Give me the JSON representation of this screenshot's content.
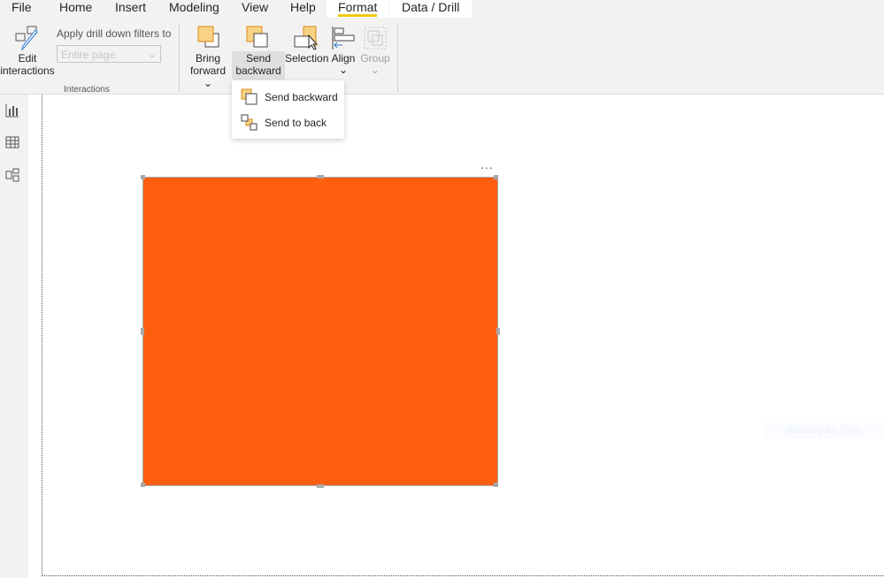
{
  "tabs": [
    {
      "label": "File"
    },
    {
      "label": "Home"
    },
    {
      "label": "Insert"
    },
    {
      "label": "Modeling"
    },
    {
      "label": "View"
    },
    {
      "label": "Help"
    },
    {
      "label": "Format",
      "active": true
    },
    {
      "label": "Data / Drill"
    }
  ],
  "ribbon": {
    "edit_interactions": {
      "line1": "Edit",
      "line2": "interactions",
      "icon": "edit-interactions-icon"
    },
    "drill_label": "Apply drill down filters to",
    "drill_value": "Entire page",
    "group_interactions": "Interactions",
    "bring_forward": {
      "line1": "Bring",
      "line2": "forward"
    },
    "send_backward": {
      "line1": "Send",
      "line2": "backward"
    },
    "selection": "Selection",
    "align": "Align",
    "group": "Group"
  },
  "menu": {
    "items": [
      {
        "label": "Send backward",
        "icon": "send-backward-icon"
      },
      {
        "label": "Send to back",
        "icon": "send-to-back-icon"
      }
    ]
  },
  "sidebar": {
    "icons": [
      "report-view-icon",
      "data-view-icon",
      "model-view-icon"
    ]
  },
  "canvas": {
    "shape_color": "#fe5e0f",
    "more_label": "...",
    "snip_label": "Rectangular Snip"
  },
  "colors": {
    "accent": "#f2c811",
    "shape": "#fe5e0f"
  }
}
